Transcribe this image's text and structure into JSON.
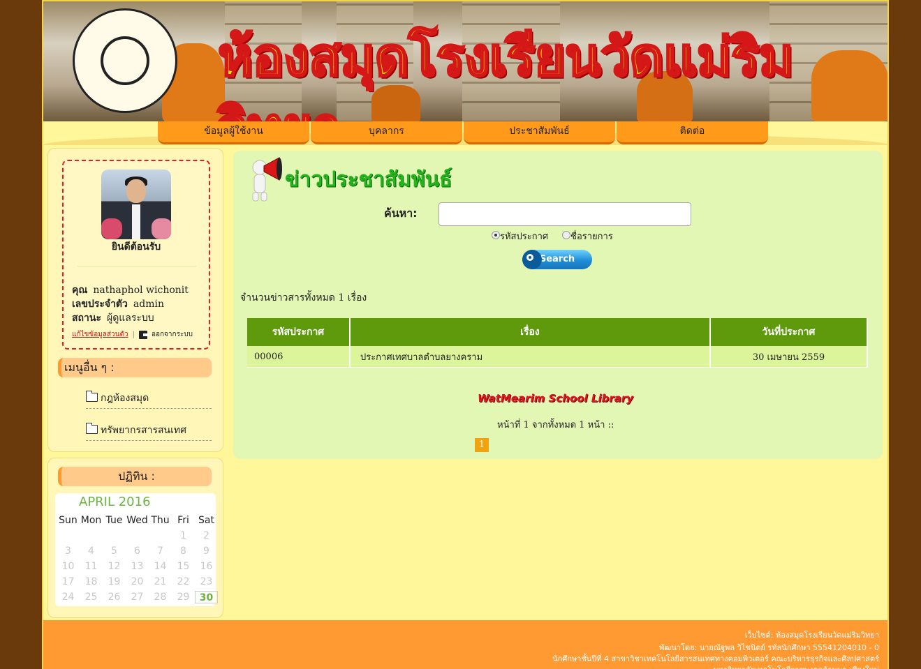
{
  "banner": {
    "title": "ห้องสมุดโรงเรียนวัดแม่ริมวิทยา"
  },
  "nav": {
    "items": [
      {
        "label": "ข้อมูลผู้ใช้งาน"
      },
      {
        "label": "บุคลากร"
      },
      {
        "label": "ประชาสัมพันธ์"
      },
      {
        "label": "ติดต่อ"
      }
    ]
  },
  "sidebar": {
    "welcome": "ยินดีต้อนรับ",
    "user": {
      "name_label": "คุณ",
      "name": "nathaphol wichonit",
      "id_label": "เลขประจำตัว",
      "id": "admin",
      "status_label": "สถานะ",
      "status": "ผู้ดูแลระบบ"
    },
    "edit_link": "แก้ไขข้อมูลส่วนตัว",
    "logout": "ออกจากระบบ",
    "other_menu_title": "เมนูอื่น ๆ :",
    "links": [
      {
        "label": "กฎห้องสมุด"
      },
      {
        "label": "ทรัพยากรสารสนเทศ"
      }
    ],
    "calendar_title": "ปฏิทิน :"
  },
  "calendar": {
    "month": "APRIL 2016",
    "weekdays": [
      "Sun",
      "Mon",
      "Tue",
      "Wed",
      "Thu",
      "Fri",
      "Sat"
    ],
    "days": [
      "",
      "",
      "",
      "",
      "",
      "1",
      "2",
      "3",
      "4",
      "5",
      "6",
      "7",
      "8",
      "9",
      "10",
      "11",
      "12",
      "13",
      "14",
      "15",
      "16",
      "17",
      "18",
      "19",
      "20",
      "21",
      "22",
      "23",
      "24",
      "25",
      "26",
      "27",
      "28",
      "29",
      "30"
    ],
    "today": "30"
  },
  "main": {
    "title": "ข่าวประชาสัมพันธ์",
    "search_label": "ค้นหา:",
    "search_value": "",
    "radio_options": [
      "รหัสประกาศ",
      "ชื่อรายการ"
    ],
    "radio_selected": "รหัสประกาศ",
    "search_button": "Search",
    "count_text": "จำนวนข่าวสารทั้งหมด 1 เรื่อง",
    "table": {
      "headers": [
        "รหัสประกาศ",
        "เรื่อง",
        "วันที่ประกาศ"
      ],
      "rows": [
        [
          "00006",
          "ประกาศเทศบาลตำบลยางคราม",
          "30 เมษายน 2559"
        ]
      ]
    },
    "library_logo": "WatMearim School Library",
    "page_info": "หน้าที่ 1 จากทั้งหมด 1 หน้า ::",
    "current_page": "1"
  },
  "footer": {
    "line1": "เว็บไซต์: ห้องสมุดโรงเรียนวัดแม่ริมวิทยา",
    "line2": "พัฒนาโดย: นายณัฐพล วิไชนิตย์ รหัสนักศึกษา 55541204010 - 0",
    "line3": "นักศึกษาชั้นปีที่ 4 สาขาวิชาเทคโนโลยีสารสนเทศทางคอมพิวเตอร์ คณะบริหารธุรกิจและศิลปศาสตร์",
    "line4": "มหาวิทยาลัยเทคโนโลยีราชมงคลล้านนา เชียงใหม่"
  },
  "colors": {
    "accent_orange": "#ff9a1a",
    "panel_green": "#e3f7b4",
    "table_header": "#5e9a0c",
    "title_green": "#24b41c",
    "page_bg": "#fff79a"
  }
}
